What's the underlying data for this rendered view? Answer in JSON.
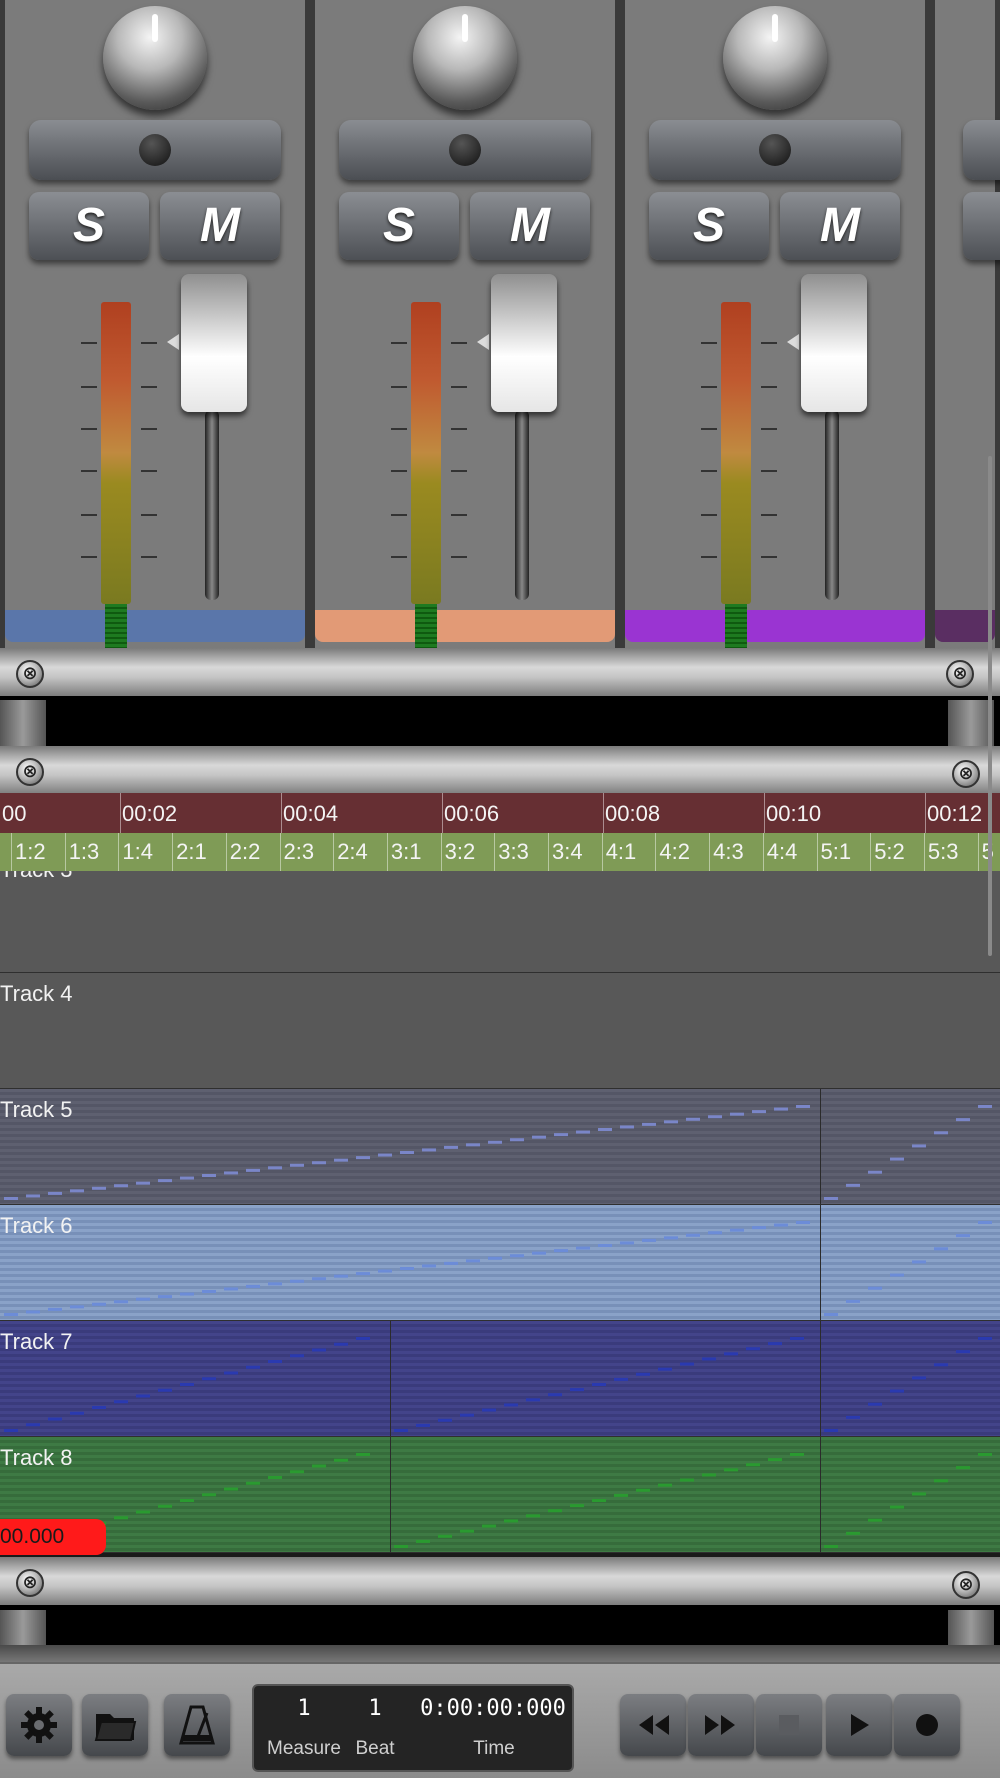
{
  "mixer": {
    "channels": [
      {
        "solo_label": "S",
        "mute_label": "M",
        "color": "#5a76aa"
      },
      {
        "solo_label": "S",
        "mute_label": "M",
        "color": "#e29a76"
      },
      {
        "solo_label": "S",
        "mute_label": "M",
        "color": "#9a34d2"
      },
      {
        "color": "#5a2e62"
      }
    ]
  },
  "timeline": {
    "time_ruler": [
      "00",
      "00:02",
      "00:04",
      "00:06",
      "00:08",
      "00:10",
      "00:12"
    ],
    "beat_ruler": [
      "1:2",
      "1:3",
      "1:4",
      "2:1",
      "2:2",
      "2:3",
      "2:4",
      "3:1",
      "3:2",
      "3:3",
      "3:4",
      "4:1",
      "4:2",
      "4:3",
      "4:4",
      "5:1",
      "5:2",
      "5:3",
      "5"
    ],
    "tracks": [
      {
        "name": "Track 3",
        "color": "#585858"
      },
      {
        "name": "Track 4",
        "color": "#585858"
      },
      {
        "name": "Track 5",
        "color": "#5e6070"
      },
      {
        "name": "Track 6",
        "color": "#8aa2c8"
      },
      {
        "name": "Track 7",
        "color": "#43448a"
      },
      {
        "name": "Track 8",
        "color": "#3e7a44"
      }
    ],
    "playhead_label": "00.000"
  },
  "transport": {
    "measure_value": "1",
    "beat_value": "1",
    "time_value": "0:00:00:000",
    "measure_label": "Measure",
    "beat_label": "Beat",
    "time_label": "Time"
  },
  "icons": [
    "settings-icon",
    "folder-icon",
    "metronome-icon",
    "rewind-icon",
    "fast-forward-icon",
    "stop-icon",
    "play-icon",
    "record-icon"
  ]
}
